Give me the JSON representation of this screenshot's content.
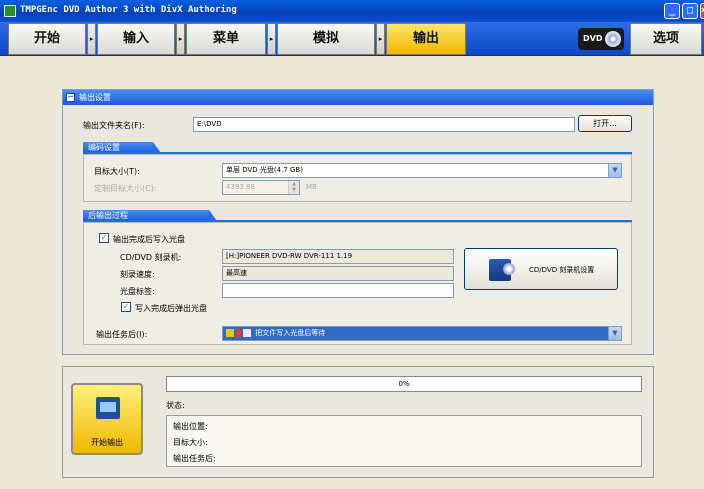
{
  "window": {
    "title": "TMPGEnc DVD Author 3 with DivX Authoring",
    "minimize": "_",
    "maximize": "□",
    "close": "×"
  },
  "toolbar": {
    "stages": [
      {
        "label": "开始",
        "active": false
      },
      {
        "label": "输入",
        "active": false
      },
      {
        "label": "菜单",
        "active": false
      },
      {
        "label": "模拟",
        "active": false
      },
      {
        "label": "输出",
        "active": true
      }
    ],
    "arrow_glyph": "▸",
    "dvd_logo": "DVD",
    "options_label": "选项"
  },
  "output_settings": {
    "header": "输出设置",
    "collapse_glyph": "−",
    "folder_label": "输出文件夹名(F):",
    "folder_value": "E:\\DVD",
    "open_button": "打开...",
    "encoding_section": "编码设置",
    "target_size_label": "目标大小(T):",
    "target_size_value": "单层 DVD 光盘(4.7 GB)",
    "custom_size_label": "定制目标大小(C):",
    "custom_size_value": "4393.88",
    "custom_size_unit": "MB",
    "post_section": "后输出过程",
    "write_disc_checkbox_label": "输出完成后写入光盘",
    "write_disc_checked": true,
    "burner_label": "CD/DVD 刻录机:",
    "burner_value": "[H:]PIONEER  DVD-RW  DVR-111  1.19",
    "speed_label": "刻录速度:",
    "speed_value": "最高速",
    "disc_label_label": "光盘标签:",
    "disc_label_value": "",
    "eject_checkbox_label": "写入完成后弹出光盘",
    "eject_checked": true,
    "burner_settings_button": "CD/DVD 刻录机设置",
    "after_task_label": "输出任务后(I):",
    "after_task_value": "把文件写入光盘后等待"
  },
  "bottom": {
    "start_button": "开始输出",
    "progress_value": 0,
    "progress_text": "0%",
    "status_label": "状态:",
    "status_rows": [
      "输出位置:",
      "目标大小:",
      "输出任务后:"
    ]
  },
  "colors": {
    "accent": "#1a5ad8",
    "active_stage": "#f0b800",
    "check": "#21a121"
  }
}
